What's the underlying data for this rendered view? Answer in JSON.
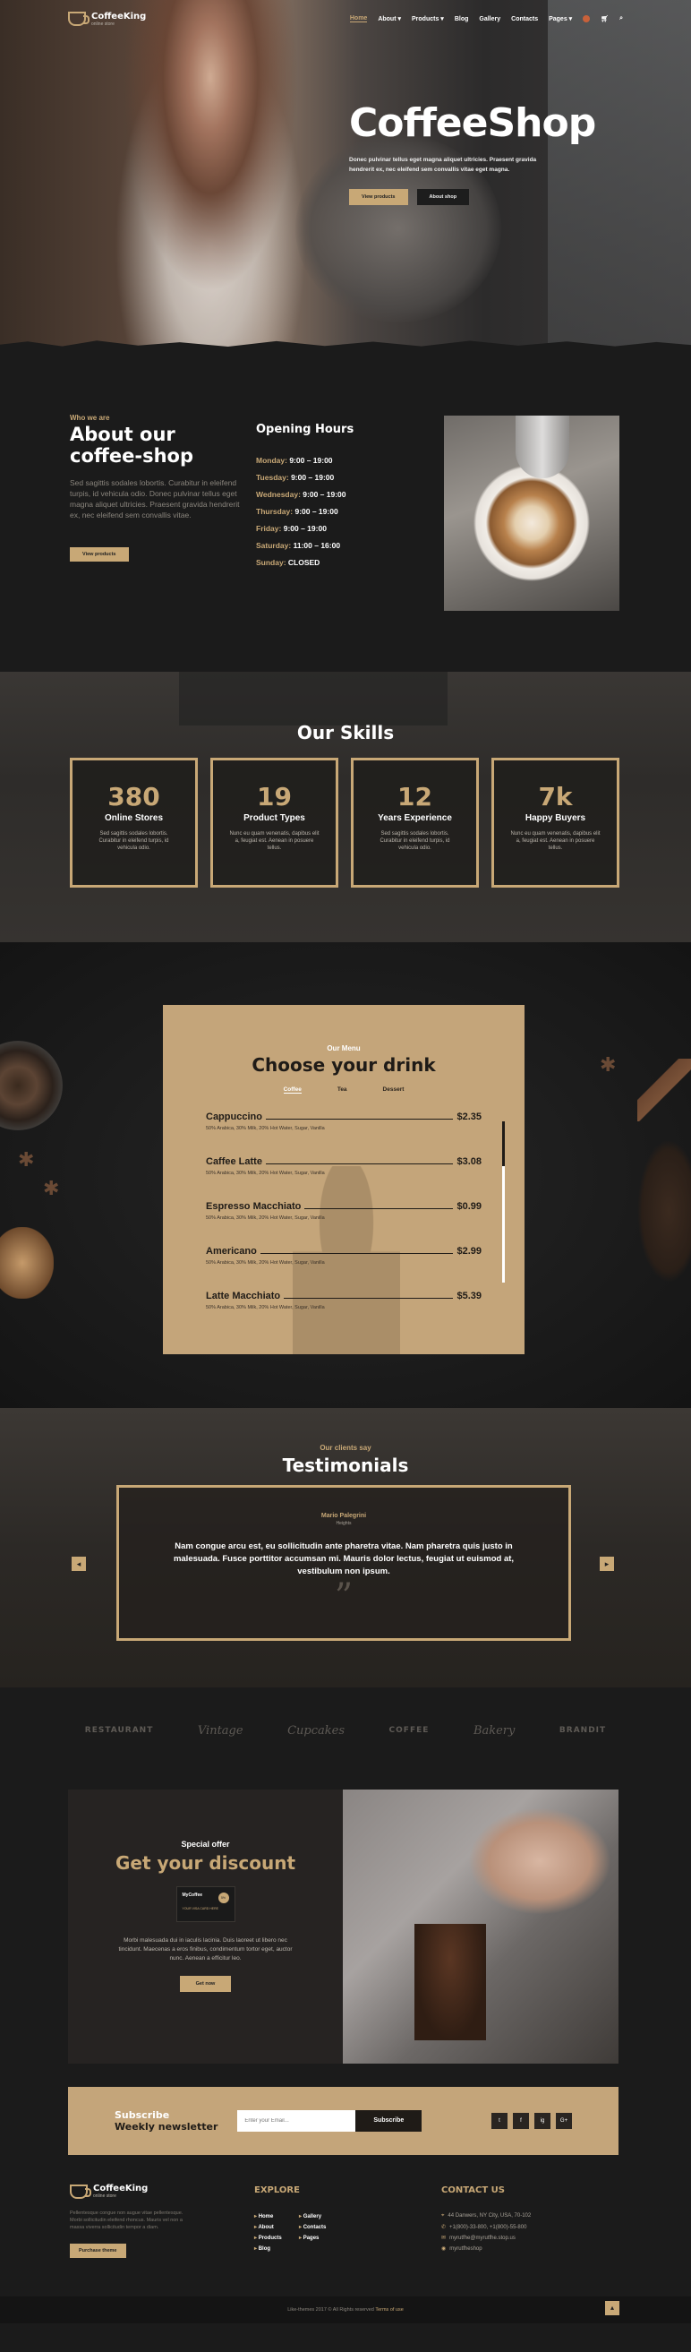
{
  "header": {
    "logo_name": "CoffeeKing",
    "logo_sub": "online store",
    "menu": [
      "Home",
      "About",
      "Products",
      "Blog",
      "Gallery",
      "Contacts",
      "Pages"
    ]
  },
  "hero": {
    "title": "CoffeeShop",
    "desc": "Donec pulvinar tellus eget magna aliquet ultricies. Praesent gravida hendrerit ex, nec eleifend sem convallis vitae eget magna.",
    "btn_primary": "View products",
    "btn_secondary": "About shop"
  },
  "about": {
    "tag": "Who we are",
    "title": "About our coffee-shop",
    "text": "Sed sagittis sodales lobortis. Curabitur in eleifend turpis, id vehicula odio. Donec pulvinar tellus eget magna aliquet ultricies. Praesent gravida hendrerit ex, nec eleifend sem convallis vitae.",
    "button": "View products",
    "hours_title": "Opening Hours",
    "hours": [
      {
        "day": "Monday:",
        "time": "9:00 – 19:00"
      },
      {
        "day": "Tuesday:",
        "time": "9:00 – 19:00"
      },
      {
        "day": "Wednesday:",
        "time": "9:00 – 19:00"
      },
      {
        "day": "Thursday:",
        "time": "9:00 – 19:00"
      },
      {
        "day": "Friday:",
        "time": "9:00 – 19:00"
      },
      {
        "day": "Saturday:",
        "time": "11:00 – 16:00"
      },
      {
        "day": "Sunday:",
        "time": "CLOSED"
      }
    ]
  },
  "skills": {
    "title": "Our Skills",
    "items": [
      {
        "num": "380",
        "label": "Online Stores",
        "desc": "Sed sagittis sodales lobortis. Curabitur in eleifend turpis, id vehicula odio."
      },
      {
        "num": "19",
        "label": "Product Types",
        "desc": "Nunc eu quam venenatis, dapibus elit a, feugiat est. Aenean in posuere tellus."
      },
      {
        "num": "12",
        "label": "Years Experience",
        "desc": "Sed sagittis sodales lobortis. Curabitur in eleifend turpis, id vehicula odio."
      },
      {
        "num": "7k",
        "label": "Happy Buyers",
        "desc": "Nunc eu quam venenatis, dapibus elit a, feugiat est. Aenean in posuere tellus."
      }
    ]
  },
  "drinks": {
    "sub": "Our Menu",
    "title": "Choose your drink",
    "tabs": [
      "Coffee",
      "Tea",
      "Dessert"
    ],
    "items": [
      {
        "name": "Cappuccino",
        "price": "$2.35",
        "desc": "50% Arabica, 30% Milk, 20% Hot Water, Sugar, Vanilla"
      },
      {
        "name": "Caffee Latte",
        "price": "$3.08",
        "desc": "50% Arabica, 30% Milk, 20% Hot Water, Sugar, Vanilla"
      },
      {
        "name": "Espresso Macchiato",
        "price": "$0.99",
        "desc": "50% Arabica, 30% Milk, 20% Hot Water, Sugar, Vanilla"
      },
      {
        "name": "Americano",
        "price": "$2.99",
        "desc": "50% Arabica, 30% Milk, 20% Hot Water, Sugar, Vanilla"
      },
      {
        "name": "Latte Macchiato",
        "price": "$5.39",
        "desc": "50% Arabica, 30% Milk, 20% Hot Water, Sugar, Vanilla"
      }
    ]
  },
  "testimonials": {
    "sub": "Our clients say",
    "title": "Testimonials",
    "name": "Mario Palegrini",
    "role": "Heights",
    "quote": "Nam congue arcu est, eu sollicitudin ante pharetra vitae. Nam pharetra quis justo in malesuada. Fusce porttitor accumsan mi. Mauris dolor lectus, feugiat ut euismod at, vestibulum non ipsum.",
    "mark": "”"
  },
  "brands": [
    "RESTAURANT",
    "Vintage",
    "Cupcakes",
    "COFFEE",
    "Bakery",
    "BRANDIT"
  ],
  "offer": {
    "sub": "Special offer",
    "title": "Get your discount",
    "card_name": "MyCoffee",
    "card_label": "YOUR VISA CARD HERE",
    "card_badge": "5%",
    "text": "Morbi malesuada dui in iaculis lacinia. Duis laoreet ut libero nec tincidunt. Maecenas a eros finibus, condimentum tortor eget, auctor nunc. Aenean a efficitur leo.",
    "button": "Get now"
  },
  "subscribe": {
    "title_top": "Subscribe",
    "title_bottom": "Weekly newsletter",
    "placeholder": "Enter your Email...",
    "button": "Subscribe",
    "socials": [
      "t",
      "f",
      "ig",
      "G+"
    ]
  },
  "footer": {
    "about_text": "Pellentesque congue non augue vitae pellentesque. Morbi sollicitudin eleifend rhoncus. Mauris vel non a massa viverra sollicitudin tempor a diam.",
    "purchase": "Purchase theme",
    "explore_title": "EXPLORE",
    "links": [
      "Home",
      "Gallery",
      "About",
      "Contacts",
      "Products",
      "Pages",
      "Blog"
    ],
    "contact_title": "CONTACT US",
    "contacts": [
      "44 Danwers, NY City, USA, 70-102",
      "+1(800)-33-800, +1(800)-55-800",
      "myrutfhe@myrutfhe.stop.us",
      "myrutfheshop"
    ],
    "copyright": "Like-themes 2017 © All Rights reserved",
    "terms": "Terms of use"
  },
  "colors": {
    "accent": "#c8a876",
    "background": "#1b1b1b"
  }
}
